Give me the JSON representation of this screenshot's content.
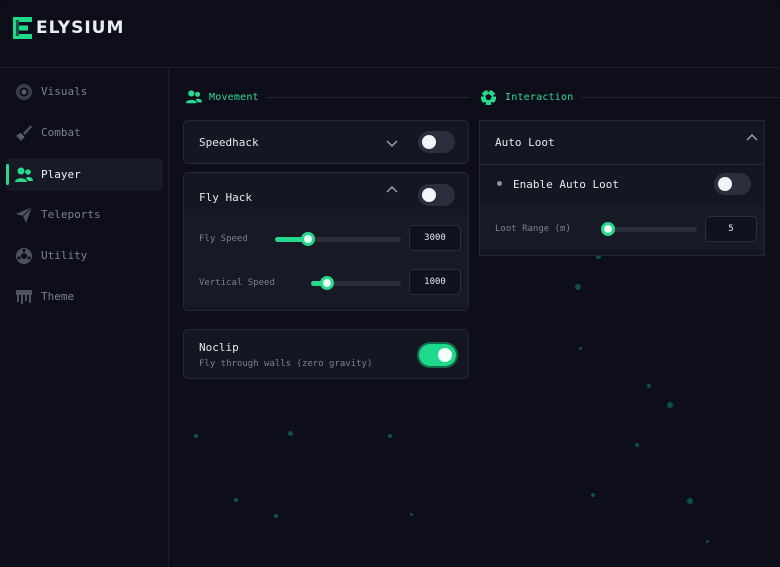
{
  "app": {
    "name": "ELYSIUM"
  },
  "sidebar": {
    "items": [
      {
        "label": "Visuals",
        "icon": "eye-icon",
        "active": false
      },
      {
        "label": "Combat",
        "icon": "sword-icon",
        "active": false
      },
      {
        "label": "Player",
        "icon": "users-icon",
        "active": true
      },
      {
        "label": "Teleports",
        "icon": "send-icon",
        "active": false
      },
      {
        "label": "Utility",
        "icon": "gear-icon",
        "active": false
      },
      {
        "label": "Theme",
        "icon": "paint-icon",
        "active": false
      }
    ]
  },
  "movement": {
    "title": "Movement",
    "speedhack": {
      "label": "Speedhack",
      "enabled": false,
      "expanded": false
    },
    "flyhack": {
      "label": "Fly Hack",
      "enabled": false,
      "expanded": true,
      "fly_speed": {
        "label": "Fly Speed",
        "value": "3000",
        "level": 0.26
      },
      "vertical_speed": {
        "label": "Vertical Speed",
        "value": "1000",
        "level": 0.18
      }
    },
    "noclip": {
      "label": "Noclip",
      "description": "Fly through walls (zero gravity)",
      "enabled": true
    }
  },
  "interaction": {
    "title": "Interaction",
    "autoloot": {
      "label": "Auto Loot",
      "expanded": true,
      "enable": {
        "label": "Enable Auto Loot",
        "enabled": false
      },
      "range": {
        "label": "Loot Range (m)",
        "value": "5",
        "level": 0.0
      }
    }
  },
  "colors": {
    "accent": "#29d98d",
    "background": "#0e0e1b",
    "card": "#141621"
  }
}
